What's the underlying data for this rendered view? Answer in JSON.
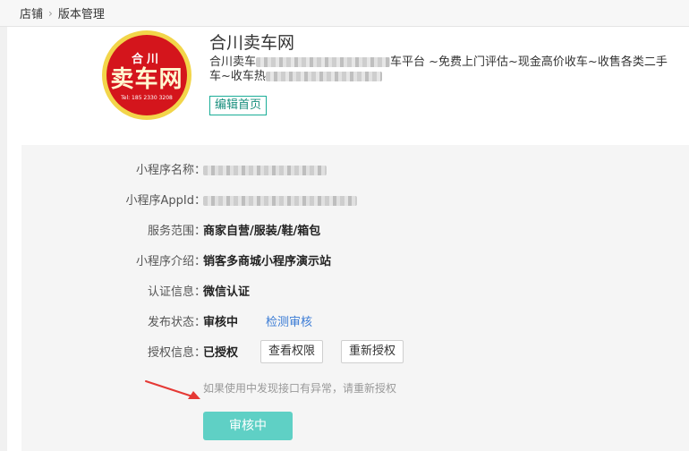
{
  "breadcrumb": {
    "root": "店铺",
    "separator": "›",
    "current": "版本管理"
  },
  "store": {
    "logo": {
      "top_text": "合川",
      "main_text": "卖车网",
      "tel": "Tel: 185 2330 3208"
    },
    "title": "合川卖车网",
    "desc_part1": "合川卖车",
    "desc_part2": "车平台 ~免费上门评估~现金高价收车~收售各类二手",
    "desc_part3": "车~收车热",
    "edit_home_label": "编辑首页"
  },
  "info": {
    "name_label": "小程序名称：",
    "appid_label": "小程序AppId：",
    "scope_label": "服务范围：",
    "scope_value": "商家自营/服装/鞋/箱包",
    "intro_label": "小程序介绍：",
    "intro_value": "销客多商城小程序演示站",
    "cert_label": "认证信息：",
    "cert_value": "微信认证",
    "publish_label": "发布状态：",
    "publish_value": "审核中",
    "check_review_label": "检测审核",
    "auth_label": "授权信息：",
    "auth_value": "已授权",
    "view_perm_label": "查看权限",
    "reauth_label": "重新授权",
    "hint": "如果使用中发现接口有异常，请重新授权",
    "status_button_label": "审核中"
  },
  "colors": {
    "accent": "#5fd0c5",
    "link": "#3a7bd5",
    "logo_red": "#d4151c",
    "logo_yellow": "#f2d54a",
    "annotation_arrow": "#e53935"
  }
}
